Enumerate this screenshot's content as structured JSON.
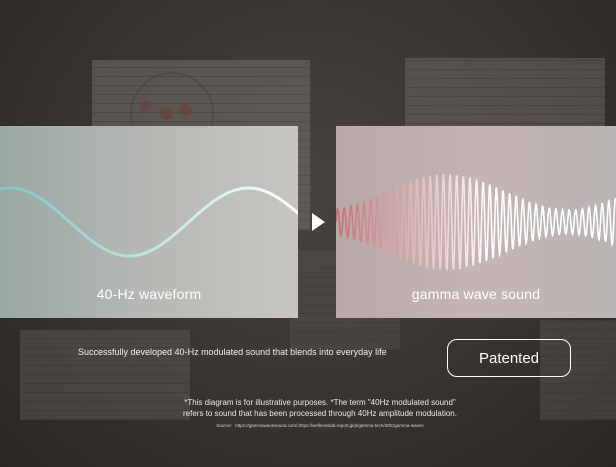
{
  "left_panel": {
    "label": "40-Hz waveform",
    "wave_color": "#ffffff",
    "wave_accent": "#7fc8c2"
  },
  "right_panel": {
    "label": "gamma wave sound",
    "wave_color": "#ffffff",
    "wave_accent": "#c96a72"
  },
  "tagline": "Successfully developed 40-Hz modulated sound that blends into everyday life",
  "badge": "Patented",
  "notes": {
    "line1": "*This diagram is for illustrative purposes. *The term \"40Hz modulated sound\"",
    "line2": "refers to sound that has been processed through 40Hz amplitude modulation.",
    "source": "Source：https://gammawavesound.com/;https://wellnesslab-report.jp/p/gamma-tech/40hzgamma-waves"
  }
}
